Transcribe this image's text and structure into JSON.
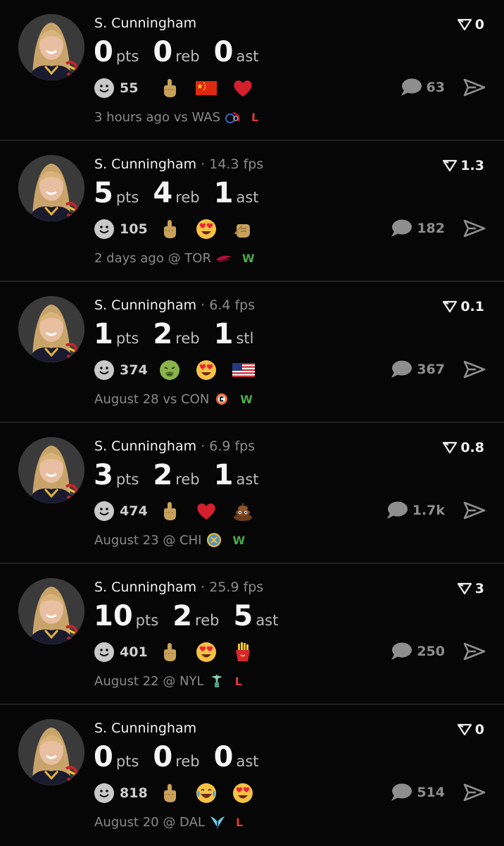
{
  "posts": [
    {
      "player": "S. Cunningham",
      "fps": "",
      "stats": [
        {
          "value": "0",
          "label": "pts"
        },
        {
          "value": "0",
          "label": "reb"
        },
        {
          "value": "0",
          "label": "ast"
        }
      ],
      "reaction_count": "55",
      "reactions": [
        "middle-finger-icon",
        "china-flag-icon",
        "red-heart-icon"
      ],
      "time": "3 hours ago",
      "venue": "vs",
      "opponent": "WAS",
      "opponent_logo": "mystics-logo-icon",
      "result": "L",
      "score": "0",
      "comments": "63"
    },
    {
      "player": "S. Cunningham",
      "fps": "14.3 fps",
      "stats": [
        {
          "value": "5",
          "label": "pts"
        },
        {
          "value": "4",
          "label": "reb"
        },
        {
          "value": "1",
          "label": "ast"
        }
      ],
      "reaction_count": "105",
      "reactions": [
        "middle-finger-icon",
        "heart-eyes-icon",
        "pointing-hand-icon"
      ],
      "time": "2 days ago",
      "venue": "@",
      "opponent": "TOR",
      "opponent_logo": "tempo-logo-icon",
      "result": "W",
      "score": "1.3",
      "comments": "182"
    },
    {
      "player": "S. Cunningham",
      "fps": "6.4 fps",
      "stats": [
        {
          "value": "1",
          "label": "pts"
        },
        {
          "value": "2",
          "label": "reb"
        },
        {
          "value": "1",
          "label": "stl"
        }
      ],
      "reaction_count": "374",
      "reactions": [
        "nauseated-face-icon",
        "heart-eyes-icon",
        "usa-flag-icon"
      ],
      "time": "August 28",
      "venue": "vs",
      "opponent": "CON",
      "opponent_logo": "sun-logo-icon",
      "result": "W",
      "score": "0.1",
      "comments": "367"
    },
    {
      "player": "S. Cunningham",
      "fps": "6.9 fps",
      "stats": [
        {
          "value": "3",
          "label": "pts"
        },
        {
          "value": "2",
          "label": "reb"
        },
        {
          "value": "1",
          "label": "ast"
        }
      ],
      "reaction_count": "474",
      "reactions": [
        "middle-finger-icon",
        "red-heart-icon",
        "poop-icon"
      ],
      "time": "August 23",
      "venue": "@",
      "opponent": "CHI",
      "opponent_logo": "sky-logo-icon",
      "result": "W",
      "score": "0.8",
      "comments": "1.7k"
    },
    {
      "player": "S. Cunningham",
      "fps": "25.9 fps",
      "stats": [
        {
          "value": "10",
          "label": "pts"
        },
        {
          "value": "2",
          "label": "reb"
        },
        {
          "value": "5",
          "label": "ast"
        }
      ],
      "reaction_count": "401",
      "reactions": [
        "middle-finger-icon",
        "heart-eyes-icon",
        "fries-icon"
      ],
      "time": "August 22",
      "venue": "@",
      "opponent": "NYL",
      "opponent_logo": "liberty-logo-icon",
      "result": "L",
      "score": "3",
      "comments": "250"
    },
    {
      "player": "S. Cunningham",
      "fps": "",
      "stats": [
        {
          "value": "0",
          "label": "pts"
        },
        {
          "value": "0",
          "label": "reb"
        },
        {
          "value": "0",
          "label": "ast"
        }
      ],
      "reaction_count": "818",
      "reactions": [
        "middle-finger-icon",
        "crying-laughing-icon",
        "heart-eyes-icon"
      ],
      "time": "August 20",
      "venue": "@",
      "opponent": "DAL",
      "opponent_logo": "wings-logo-icon",
      "result": "L",
      "score": "0",
      "comments": "514"
    }
  ],
  "colors": {
    "win": "#4aaa4a",
    "loss": "#d93b3b",
    "background": "#060606"
  }
}
